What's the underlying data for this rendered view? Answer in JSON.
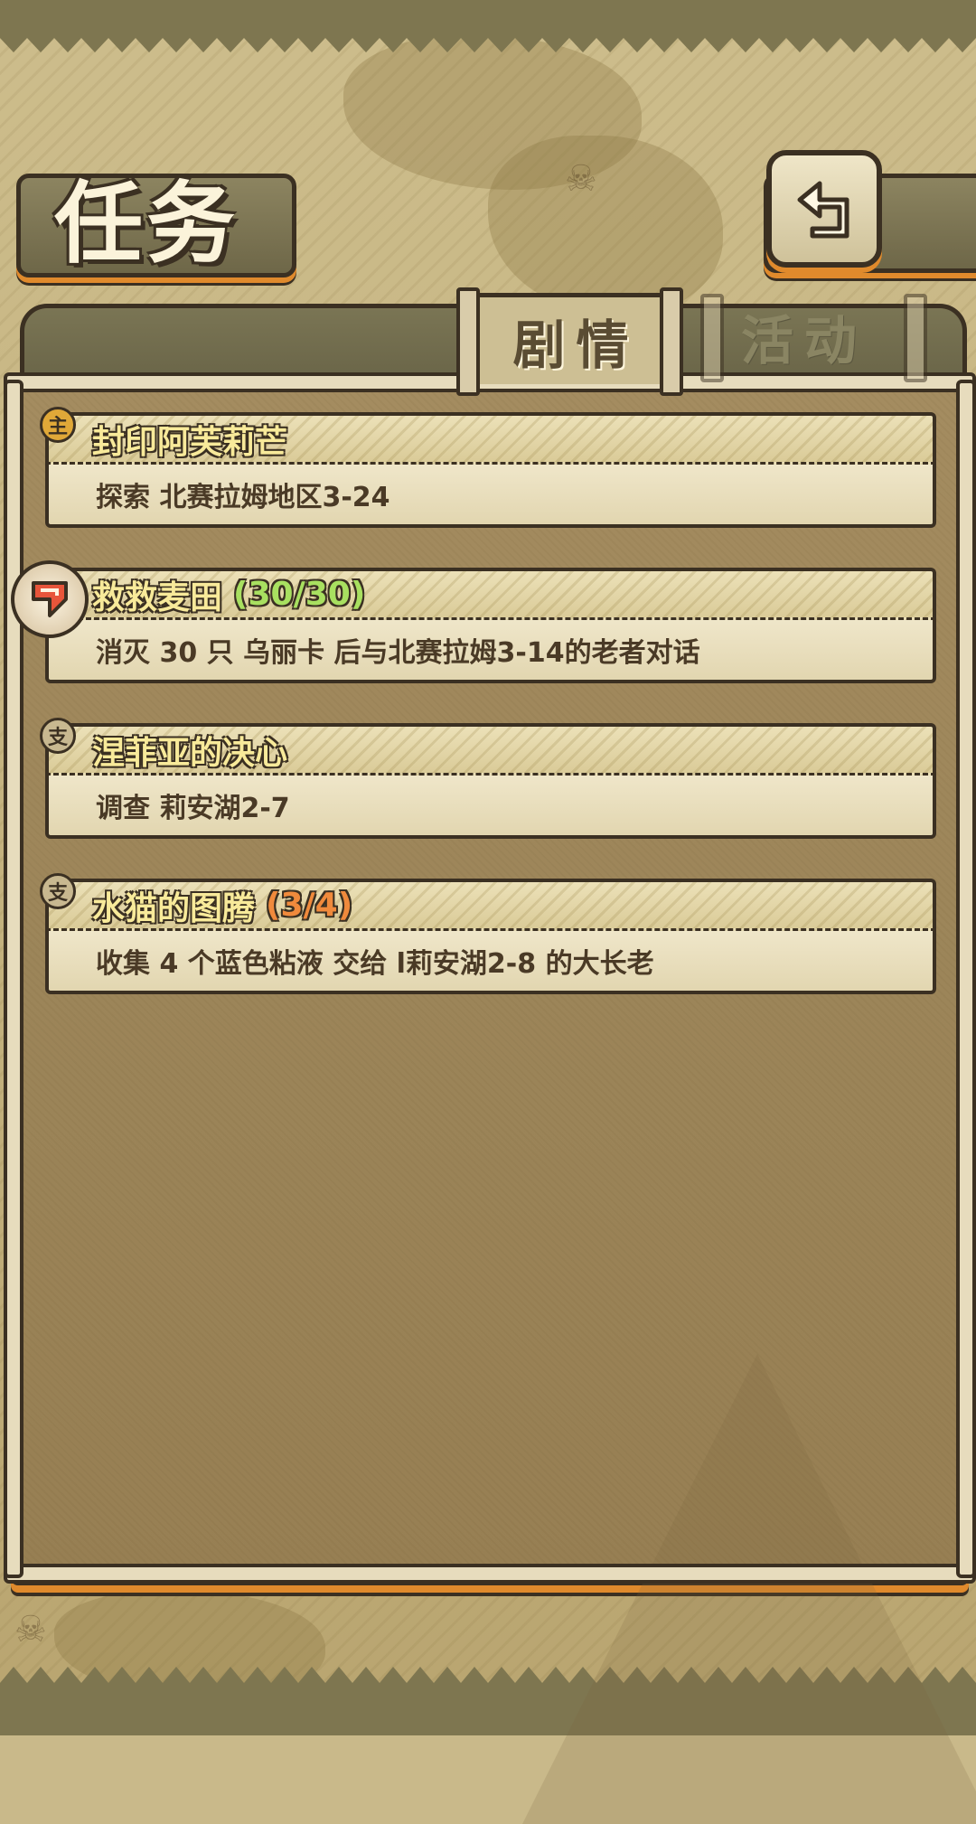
{
  "header": {
    "title": "任务"
  },
  "tabs": [
    {
      "label": "剧情",
      "active": true
    },
    {
      "label": "活动",
      "active": false
    }
  ],
  "quests": [
    {
      "badge": "主",
      "badge_color": "#e0a838",
      "title": "封印阿芙莉芒",
      "progress": "",
      "progress_color": "",
      "description": "探索 北赛拉姆地区3-24",
      "tracked": false
    },
    {
      "badge": "",
      "badge_color": "",
      "title": "救救麦田",
      "progress": "(30/30)",
      "progress_color": "#a8e060",
      "description": "消灭 30 只 乌丽卡 后与北赛拉姆3-14的老者对话",
      "tracked": true
    },
    {
      "badge": "支",
      "badge_color": "#c8b890",
      "title": "涅菲亚的决心",
      "progress": "",
      "progress_color": "",
      "description": "调查 莉安湖2-7",
      "tracked": false
    },
    {
      "badge": "支",
      "badge_color": "#c8b890",
      "title": "水猫的图腾",
      "progress": "(3/4)",
      "progress_color": "#f08a3c",
      "description": "收集 4 个蓝色粘液 交给 l莉安湖2-8 的大长老",
      "tracked": false
    }
  ],
  "icons": {
    "back": "return-arrow-icon",
    "track": "track-marker-icon",
    "skull": "skull-icon"
  },
  "colors": {
    "accent_orange": "#e08a2c",
    "outline": "#3b3022",
    "title_yellow": "#f8ea9a"
  }
}
